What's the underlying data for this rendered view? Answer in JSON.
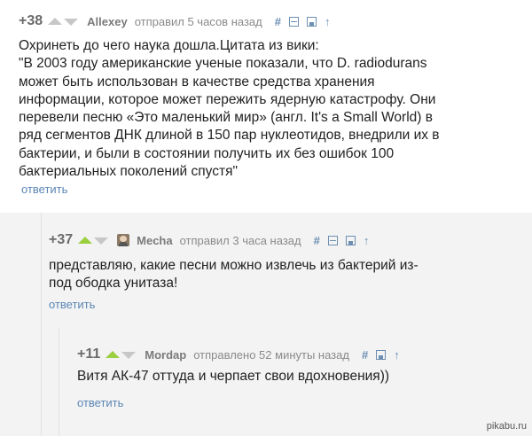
{
  "comments": [
    {
      "rating": "+38",
      "username": "Allexey",
      "meta": "отправил 5 часов назад",
      "text_lines": [
        "Охринеть до чего наука дошла.Цитата из вики:",
        "\"В 2003 году американские ученые показали, что D. radiodurans",
        "может быть использован в качестве средства хранения",
        "информации, которое может пережить ядерную катастрофу. Они",
        "перевели песню «Это маленький мир» (англ. It's a Small World) в",
        "ряд сегментов ДНК длиной в 150 пар нуклеотидов, внедрили их в",
        "бактерии, и были в состоянии получить их без ошибок 100",
        "бактериальных поколений спустя\""
      ],
      "reply": "ответить"
    },
    {
      "rating": "+37",
      "username": "Mecha",
      "meta": "отправил 3 часа назад",
      "text_lines": [
        "представляю, какие песни можно извлечь из бактерий из-",
        "под ободка унитаза!"
      ],
      "reply": "ответить"
    },
    {
      "rating": "+11",
      "username": "Mordap",
      "meta": "отправлено 52 минуты назад",
      "text_lines": [
        "Витя АК-47 оттуда и черпает свои вдохновения))"
      ],
      "reply": "ответить"
    }
  ],
  "tools": {
    "hash": "#",
    "up": "↑"
  },
  "watermark": "pikabu.ru",
  "colors": {
    "upvote_active": "#9bcf3f",
    "link": "#5b86b5",
    "nested_bg": "#f3f3f3"
  }
}
